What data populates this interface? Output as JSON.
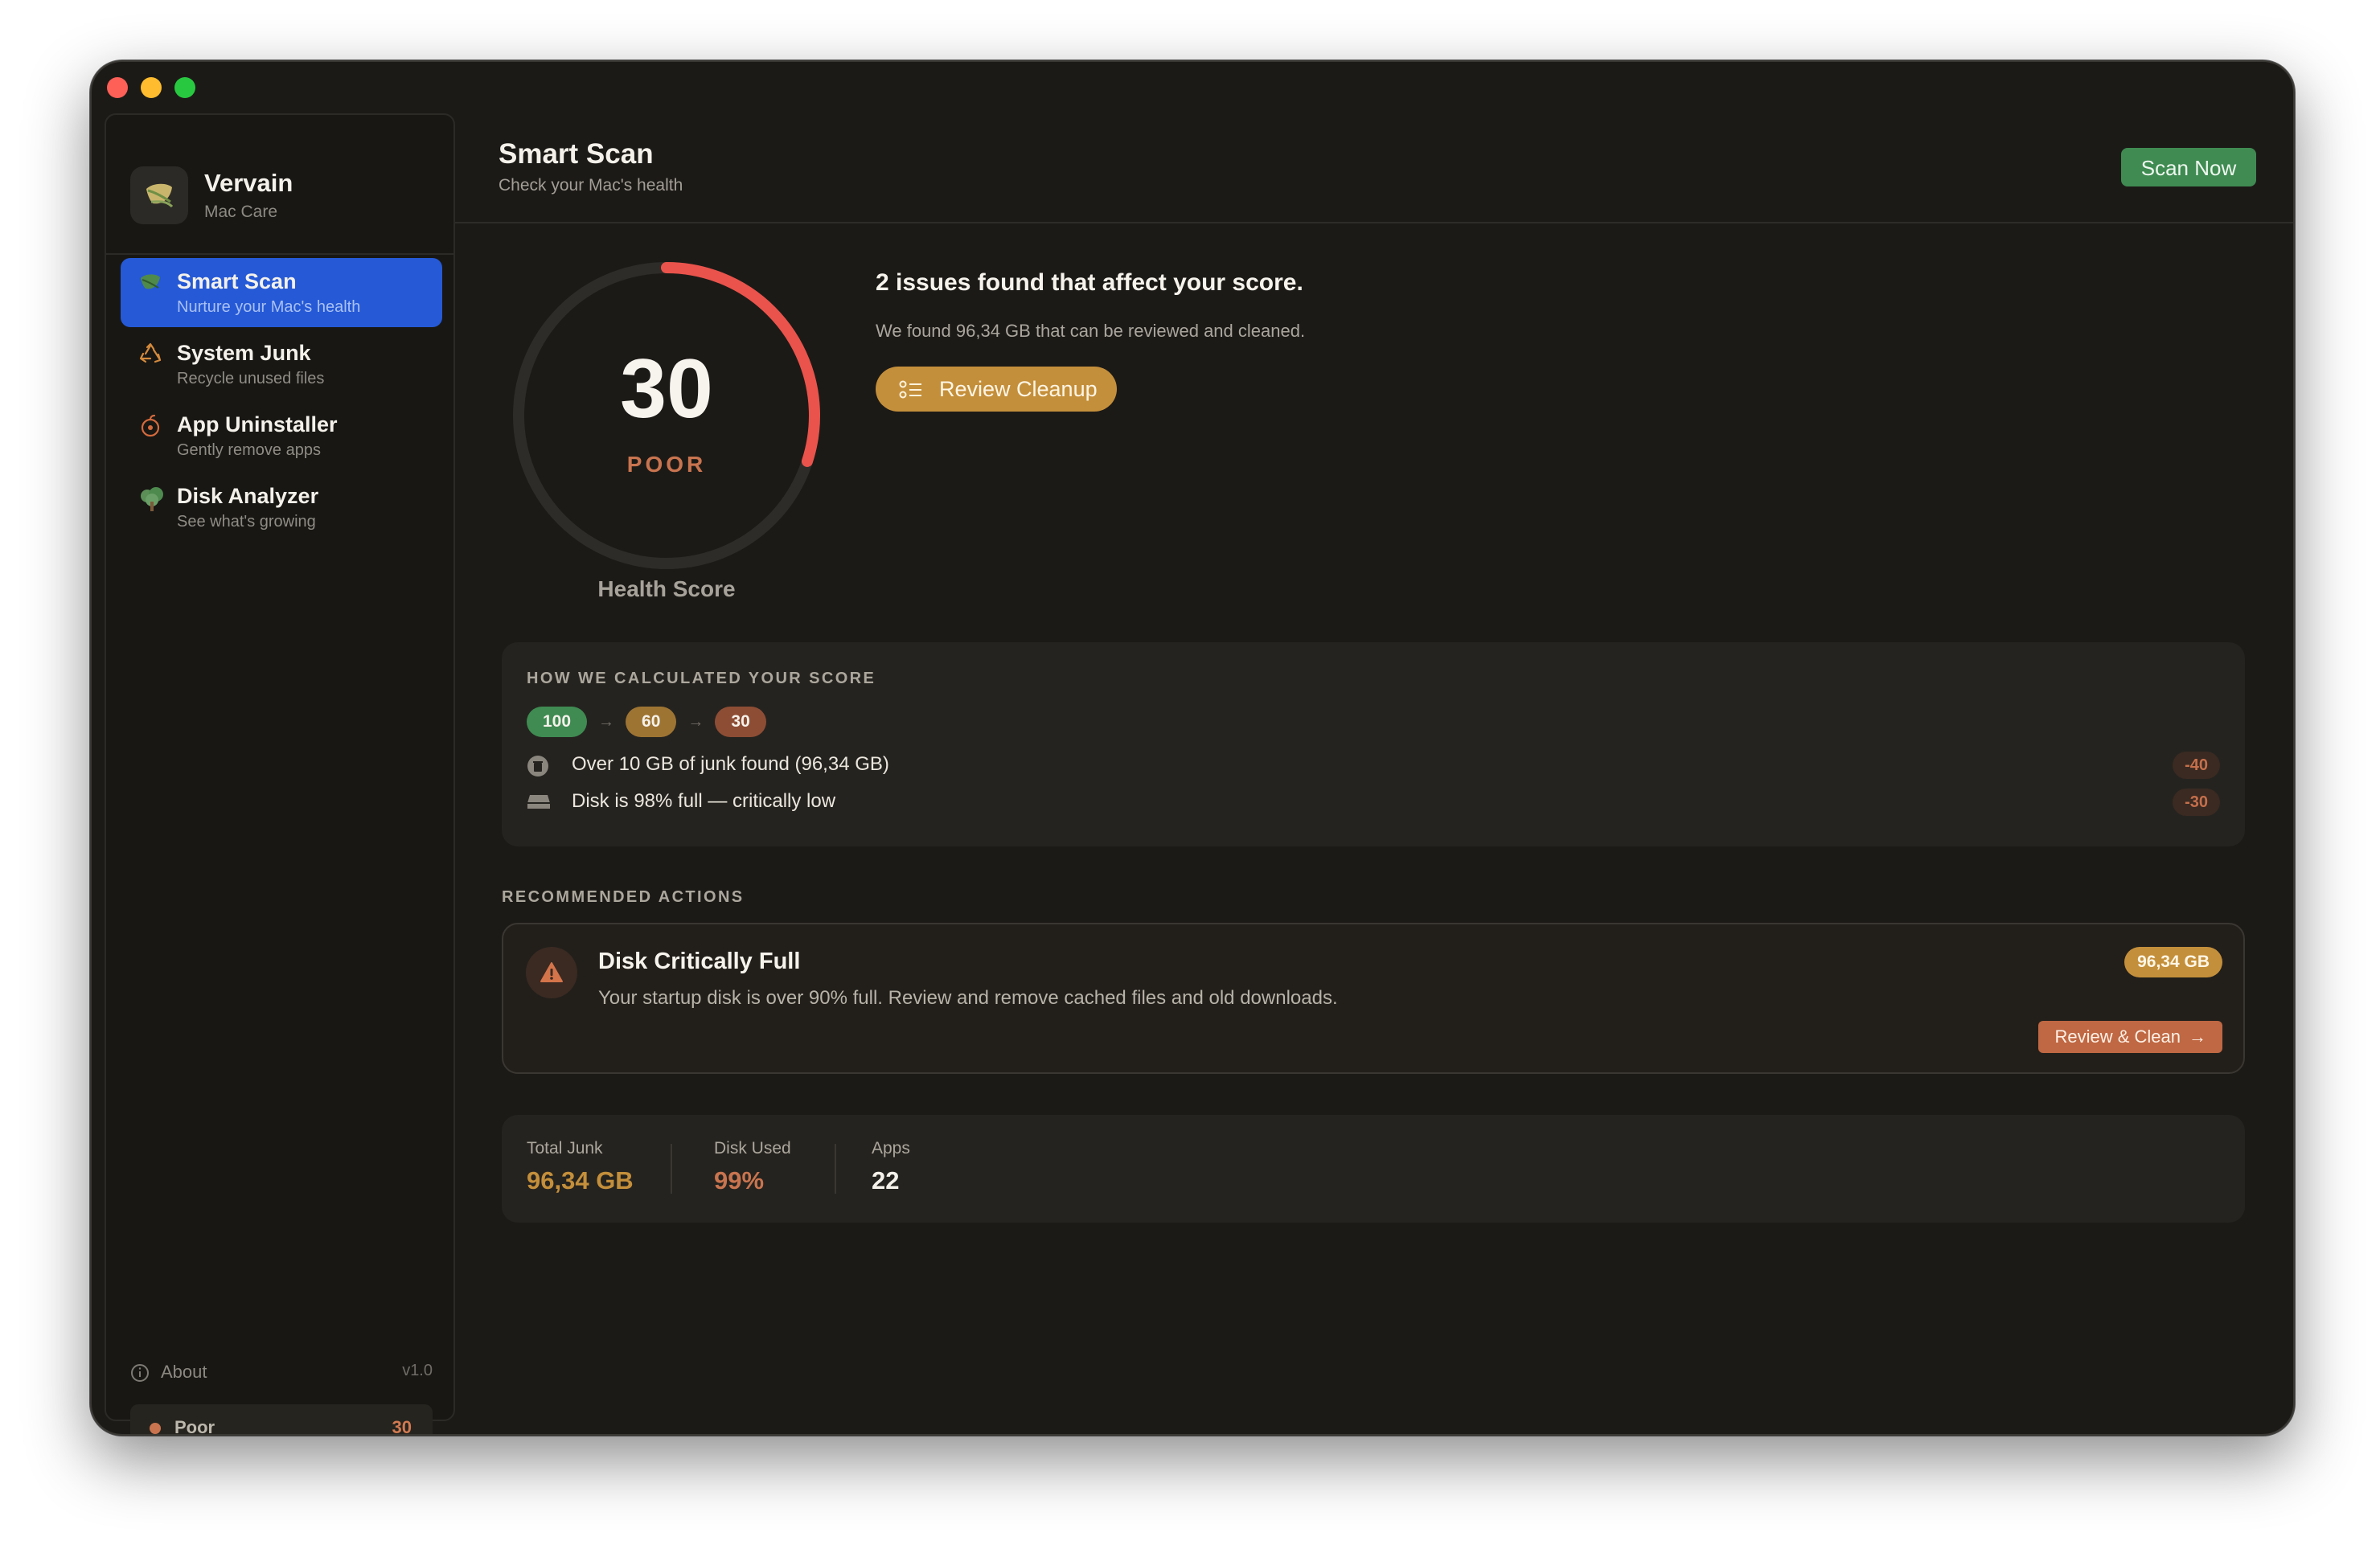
{
  "window": {
    "traffic_lights": [
      "close",
      "minimize",
      "zoom"
    ]
  },
  "sidebar": {
    "brand": {
      "name": "Vervain",
      "subtitle": "Mac Care",
      "icon": "leaf-icon"
    },
    "items": [
      {
        "label": "Smart Scan",
        "subtitle": "Nurture your Mac's health",
        "icon": "leaf-icon",
        "active": true
      },
      {
        "label": "System Junk",
        "subtitle": "Recycle unused files",
        "icon": "recycle-icon",
        "active": false
      },
      {
        "label": "App Uninstaller",
        "subtitle": "Gently remove apps",
        "icon": "apple-icon",
        "active": false
      },
      {
        "label": "Disk Analyzer",
        "subtitle": "See what's growing",
        "icon": "tree-icon",
        "active": false
      }
    ],
    "about": {
      "label": "About",
      "version": "v1.0"
    },
    "status": {
      "label": "Poor",
      "score": "30"
    }
  },
  "header": {
    "title": "Smart Scan",
    "subtitle": "Check your Mac's health",
    "scan_button": "Scan Now"
  },
  "health": {
    "score": "30",
    "score_fraction": 0.3,
    "rating": "POOR",
    "caption": "Health Score"
  },
  "issues": {
    "title": "2 issues found that affect your score.",
    "description": "We found 96,34 GB that can be reviewed and cleaned.",
    "review_button": "Review Cleanup"
  },
  "calculation": {
    "heading": "HOW WE CALCULATED YOUR SCORE",
    "chain": [
      "100",
      "60",
      "30"
    ],
    "rows": [
      {
        "icon": "trash-icon",
        "text": "Over 10 GB of junk found (96,34 GB)",
        "penalty": "-40"
      },
      {
        "icon": "disk-icon",
        "text": "Disk is 98% full — critically low",
        "penalty": "-30"
      }
    ]
  },
  "recommended": {
    "heading": "RECOMMENDED ACTIONS",
    "card": {
      "icon": "warning-icon",
      "title": "Disk Critically Full",
      "description": "Your startup disk is over 90% full. Review and remove cached files and old downloads.",
      "badge": "96,34 GB",
      "button": "Review & Clean"
    }
  },
  "stats": [
    {
      "label": "Total Junk",
      "value": "96,34 GB",
      "color": "#c48f3b"
    },
    {
      "label": "Disk Used",
      "value": "99%",
      "color": "#c9744f"
    },
    {
      "label": "Apps",
      "value": "22",
      "color": "#f4f1ea"
    }
  ],
  "colors": {
    "accent_blue": "#2559d6",
    "scan_green": "#3f8b52",
    "gold": "#c48f3b",
    "rust": "#c9744f",
    "gauge_red": "#e9534b"
  }
}
